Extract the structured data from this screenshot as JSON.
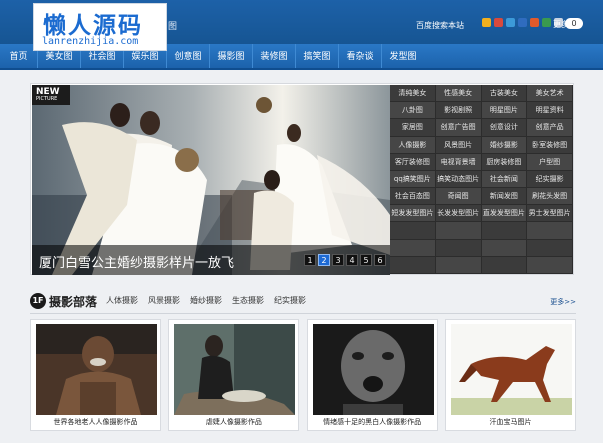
{
  "header": {
    "logo_text": "懒人源码",
    "logo_url": "lanrenzhijia.com",
    "logo_after": "图",
    "baidu_link": "百度搜索本站",
    "share_more": "更多",
    "share_count": "0",
    "share_icons": [
      {
        "name": "qzone-icon",
        "color": "#f2b01e"
      },
      {
        "name": "weibo-icon",
        "color": "#d84a3d"
      },
      {
        "name": "tencent-weibo-icon",
        "color": "#3c9ad8"
      },
      {
        "name": "renren-icon",
        "color": "#2f6cbf"
      },
      {
        "name": "kaixin-icon",
        "color": "#e05a2b"
      },
      {
        "name": "douban-icon",
        "color": "#3a9a4f"
      },
      {
        "name": "email-icon",
        "color": "#c9d4e2"
      }
    ]
  },
  "nav": [
    "首页",
    "美女图",
    "社会图",
    "娱乐图",
    "创意图",
    "摄影图",
    "装修图",
    "搞笑图",
    "看杂谈",
    "发型图"
  ],
  "hero": {
    "badge": "NEW",
    "badge_sub": "PICTURE",
    "caption": "厦门白雪公主婚纱摄影样片一放飞",
    "pages": [
      "1",
      "2",
      "3",
      "4",
      "5",
      "6"
    ],
    "active_page": "2"
  },
  "tags": [
    "清纯美女",
    "性感美女",
    "古装美女",
    "美女艺术",
    "八卦图",
    "影视剧照",
    "明星图片",
    "明星资料",
    "家居图",
    "创意广告图",
    "创意设计",
    "创意产品",
    "人像摄影",
    "风景图片",
    "婚纱摄影",
    "卧室装修图",
    "客厅装修图",
    "电视背景墙",
    "厨房装修图",
    "户型图",
    "qq搞笑图片",
    "搞笑动态图片",
    "社会新闻",
    "纪实摄影",
    "社会百态图",
    "奇闻图",
    "新闻发图",
    "刷花头发图",
    "短发发型图片",
    "长发发型图片",
    "直发发型图片",
    "男士发型图片",
    "",
    "",
    "",
    "",
    "",
    "",
    "",
    "",
    "",
    "",
    "",
    ""
  ],
  "section": {
    "floor": "1F",
    "title": "摄影部落",
    "subnav": [
      "人体摄影",
      "风景摄影",
      "婚纱摄影",
      "生态摄影",
      "纪实摄影"
    ],
    "more": "更多>>"
  },
  "thumbs": [
    {
      "caption": "世界各地老人人像摄影作品"
    },
    {
      "caption": "虐婕人像摄影作品"
    },
    {
      "caption": "情绪感十足的黑白人像摄影作品"
    },
    {
      "caption": "汗血宝马图片"
    }
  ]
}
